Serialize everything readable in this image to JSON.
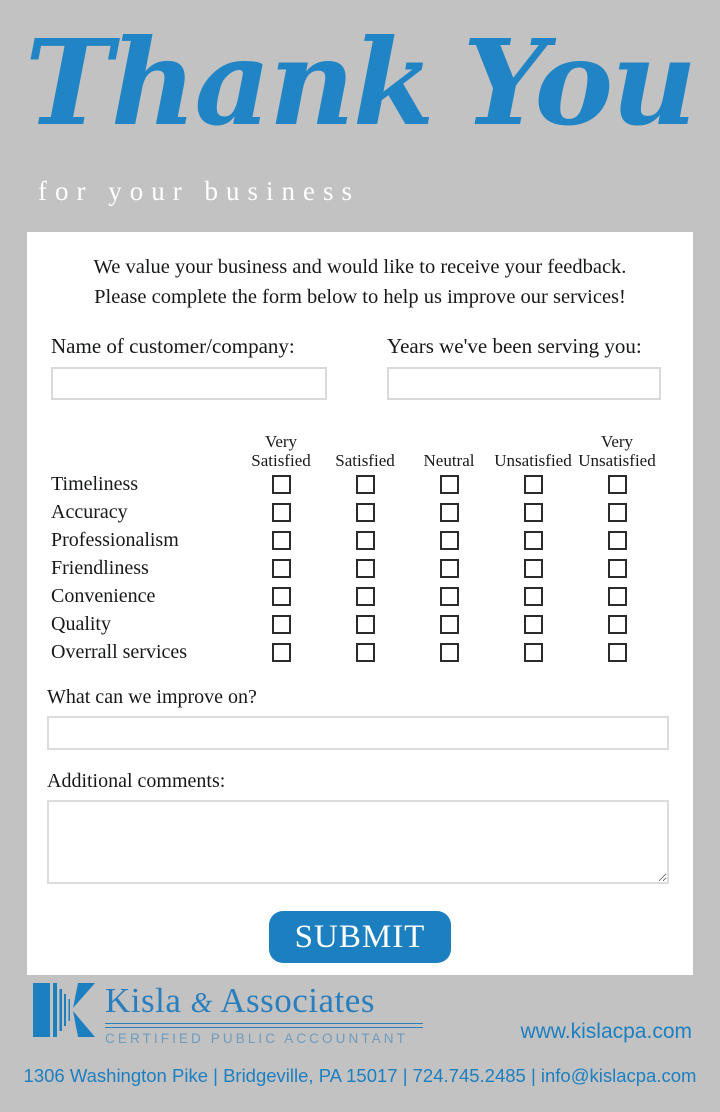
{
  "header": {
    "title_word_1": "Thank",
    "title_word_2": "You",
    "subtitle": "for your business"
  },
  "intro": {
    "line_1": "We value your business and would like to receive your feedback.",
    "line_2": "Please complete the form below to help us improve our services!"
  },
  "fields": {
    "name_label": "Name of customer/company:",
    "name_value": "",
    "years_label": "Years we've been serving you:",
    "years_value": ""
  },
  "matrix": {
    "columns": [
      "Very Satisfied",
      "Satisfied",
      "Neutral",
      "Unsatisfied",
      "Very Unsatisfied"
    ],
    "column_lines": [
      [
        "Very",
        "Satisfied"
      ],
      [
        "",
        "Satisfied"
      ],
      [
        "",
        "Neutral"
      ],
      [
        "",
        "Unsatisfied"
      ],
      [
        "Very",
        "Unsatisfied"
      ]
    ],
    "rows": [
      "Timeliness",
      "Accuracy",
      "Professionalism",
      "Friendliness",
      "Convenience",
      "Quality",
      "Overrall services"
    ]
  },
  "questions": {
    "improve_label": "What can we improve on?",
    "improve_value": "",
    "comments_label": "Additional comments:",
    "comments_value": ""
  },
  "submit": {
    "label": "SUBMIT"
  },
  "footer": {
    "company_name_part_1": "Kisla",
    "company_name_amp": "&",
    "company_name_part_2": "Associates",
    "tagline": "CERTIFIED PUBLIC ACCOUNTANT",
    "website": "www.kislacpa.com",
    "contact": "1306 Washington Pike  |  Bridgeville, PA 15017  |  724.745.2485 | info@kislacpa.com"
  },
  "colors": {
    "brand_blue": "#1c7fc0",
    "script_blue": "#2185c5",
    "background_gray": "#c2c2c2",
    "card_white": "#ffffff"
  }
}
